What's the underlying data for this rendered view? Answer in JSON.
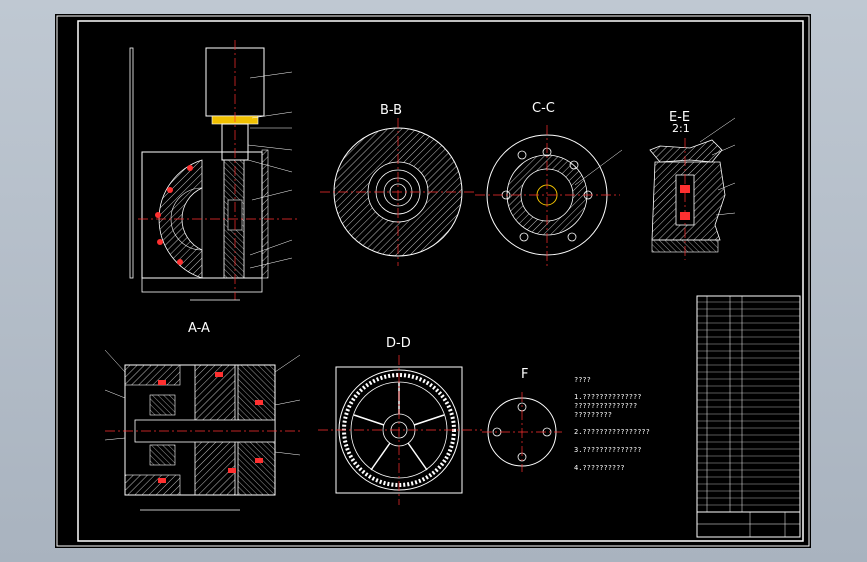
{
  "views": {
    "bb": "B-B",
    "cc": "C-C",
    "ee": "E-E",
    "ee_scale": "2:1",
    "aa": "A-A",
    "dd": "D-D",
    "f": "F"
  },
  "notes": {
    "heading": "????",
    "line1": "1.??????????????",
    "line1b": "???????????????",
    "line1c": "?????????",
    "line2": "2.????????????????",
    "line3": "3.??????????????",
    "line4": "4.??????????"
  },
  "colors": {
    "frame": "#ffffff",
    "center": "#ff3030",
    "hatch": "#c8c8c8",
    "leader": "#ffffff"
  }
}
